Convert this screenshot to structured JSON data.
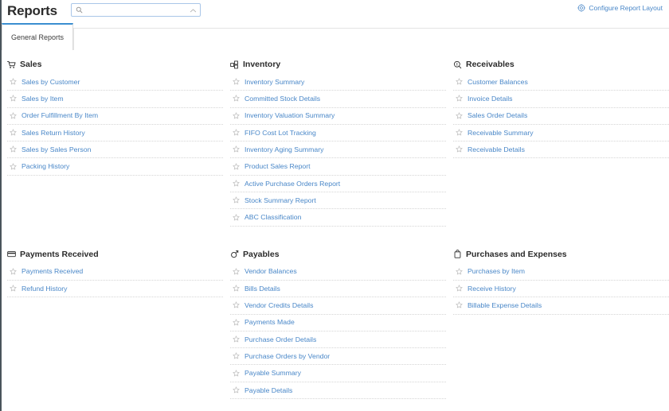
{
  "header": {
    "title": "Reports",
    "search": {
      "value": "",
      "placeholder": "",
      "icon": "search-icon",
      "collapse_icon": "chevron-up-icon"
    },
    "configure": {
      "label": "Configure Report Layout",
      "icon": "gear-icon"
    }
  },
  "tabs": [
    {
      "label": "General Reports",
      "active": true
    }
  ],
  "colors": {
    "link": "#4987c8",
    "tab_active_border": "#3a8ed0",
    "heading": "#2b2b2b",
    "separator": "#d5d5d5",
    "search_border": "#a9c6e8"
  },
  "sections": [
    {
      "title": "Sales",
      "icon": "shopping-cart-icon",
      "items": [
        "Sales by Customer",
        "Sales by Item",
        "Order Fulfillment By Item",
        "Sales Return History",
        "Sales by Sales Person",
        "Packing History"
      ]
    },
    {
      "title": "Inventory",
      "icon": "boxes-icon",
      "items": [
        "Inventory Summary",
        "Committed Stock Details",
        "Inventory Valuation Summary",
        "FIFO Cost Lot Tracking",
        "Inventory Aging Summary",
        "Product Sales Report",
        "Active Purchase Orders Report",
        "Stock Summary Report",
        "ABC Classification"
      ]
    },
    {
      "title": "Receivables",
      "icon": "coin-magnifier-icon",
      "items": [
        "Customer Balances",
        "Invoice Details",
        "Sales Order Details",
        "Receivable Summary",
        "Receivable Details"
      ]
    },
    {
      "title": "Payments Received",
      "icon": "credit-card-icon",
      "items": [
        "Payments Received",
        "Refund History"
      ]
    },
    {
      "title": "Payables",
      "icon": "payables-icon",
      "items": [
        "Vendor Balances",
        "Bills Details",
        "Vendor Credits Details",
        "Payments Made",
        "Purchase Order Details",
        "Purchase Orders by Vendor",
        "Payable Summary",
        "Payable Details"
      ]
    },
    {
      "title": "Purchases and Expenses",
      "icon": "shopping-bag-icon",
      "items": [
        "Purchases by Item",
        "Receive History",
        "Billable Expense Details"
      ]
    }
  ],
  "favorite_icon": "star-outline-icon"
}
